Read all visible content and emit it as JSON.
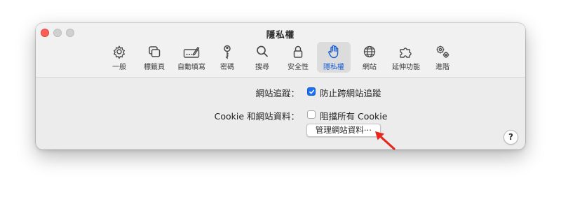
{
  "window": {
    "title": "隱私權"
  },
  "tabs": [
    {
      "label": "一般",
      "icon": "gear-icon"
    },
    {
      "label": "標籤頁",
      "icon": "tabs-icon"
    },
    {
      "label": "自動填寫",
      "icon": "autofill-icon"
    },
    {
      "label": "密碼",
      "icon": "key-icon"
    },
    {
      "label": "搜尋",
      "icon": "search-icon"
    },
    {
      "label": "安全性",
      "icon": "lock-icon"
    },
    {
      "label": "隱私權",
      "icon": "hand-icon",
      "selected": true
    },
    {
      "label": "網站",
      "icon": "globe-icon"
    },
    {
      "label": "延伸功能",
      "icon": "puzzle-icon"
    },
    {
      "label": "進階",
      "icon": "gears-icon"
    }
  ],
  "privacy": {
    "tracking_label": "網站追蹤：",
    "tracking_option": "防止跨網站追蹤",
    "tracking_checked": true,
    "cookie_label": "Cookie 和網站資料：",
    "cookie_option": "阻擋所有 Cookie",
    "cookie_checked": false,
    "manage_button": "管理網站資料⋯"
  },
  "help": {
    "label": "?"
  },
  "colors": {
    "accent": "#1a6ff2",
    "selected_label": "#1a5fd6",
    "annotation_arrow": "#e8281e",
    "close": "#fe5f57"
  }
}
